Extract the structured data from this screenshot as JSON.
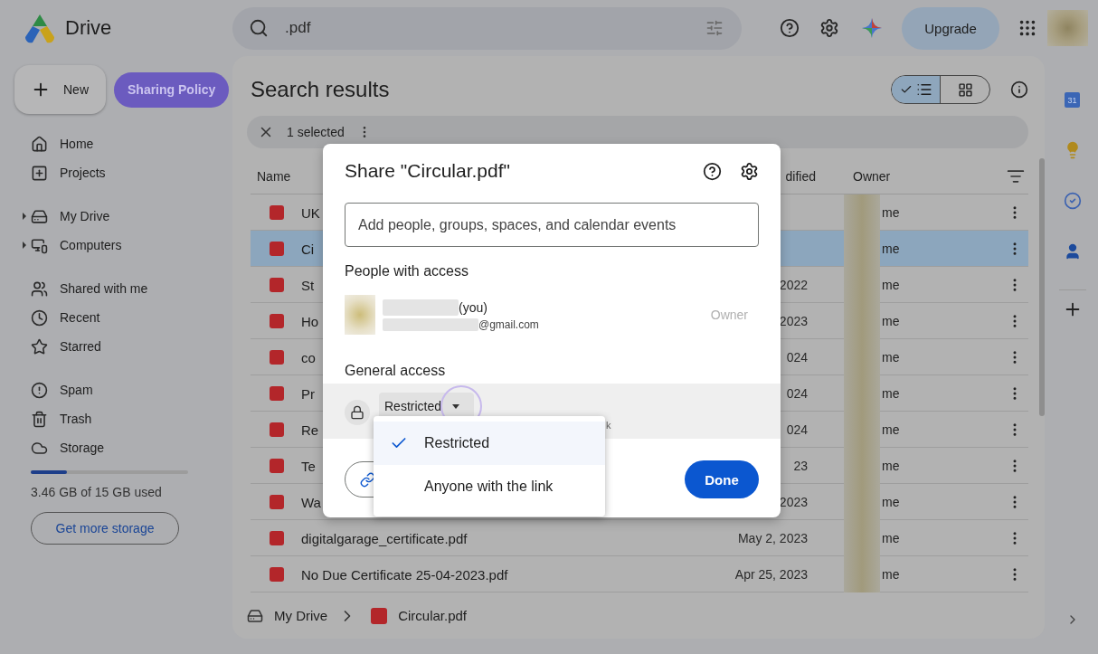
{
  "app": {
    "name": "Drive"
  },
  "search": {
    "value": ".pdf"
  },
  "topbar": {
    "upgrade": "Upgrade"
  },
  "sidebar": {
    "new_button": "New",
    "policy_button": "Sharing Policy",
    "groups": [
      [
        {
          "label": "Home",
          "expandable": false
        },
        {
          "label": "Projects",
          "expandable": false
        }
      ],
      [
        {
          "label": "My Drive",
          "expandable": true
        },
        {
          "label": "Computers",
          "expandable": true
        }
      ],
      [
        {
          "label": "Shared with me",
          "expandable": false
        },
        {
          "label": "Recent",
          "expandable": false
        },
        {
          "label": "Starred",
          "expandable": false
        }
      ],
      [
        {
          "label": "Spam",
          "expandable": false
        },
        {
          "label": "Trash",
          "expandable": false
        },
        {
          "label": "Storage",
          "expandable": false
        }
      ]
    ],
    "storage": {
      "level": 0.23,
      "text": "3.46 GB of 15 GB used",
      "button": "Get more storage"
    }
  },
  "main": {
    "title": "Search results",
    "views": [
      {
        "kind": "list",
        "selected": true
      },
      {
        "kind": "grid",
        "selected": false
      }
    ],
    "selection": {
      "count_text": "1 selected"
    },
    "columns": [
      "Name",
      "dified",
      "Owner"
    ],
    "rows": [
      {
        "name": "UK",
        "owner": "me",
        "selected": false
      },
      {
        "name": "Ci",
        "owner": "me",
        "selected": true
      },
      {
        "name": "St",
        "date": "2022",
        "owner": "me",
        "selected": false
      },
      {
        "name": "Ho",
        "date": "2023",
        "owner": "me",
        "selected": false
      },
      {
        "name": "co",
        "date": "024",
        "owner": "me",
        "selected": false
      },
      {
        "name": "Pr",
        "date": "024",
        "owner": "me",
        "selected": false
      },
      {
        "name": "Re",
        "date": "024",
        "owner": "me",
        "selected": false
      },
      {
        "name": "Te",
        "date": "23",
        "owner": "me",
        "selected": false
      },
      {
        "name": "Wa",
        "date": "2023",
        "owner": "me",
        "selected": false
      },
      {
        "name": "digitalgarage_certificate.pdf",
        "date": "May 2, 2023",
        "owner": "me",
        "selected": false
      },
      {
        "name": "No Due Certificate 25-04-2023.pdf",
        "date": "Apr 25, 2023",
        "owner": "me",
        "selected": false
      }
    ],
    "breadcrumb": [
      {
        "kind": "drive",
        "label": "My Drive"
      },
      {
        "kind": "pdf",
        "label": "Circular.pdf"
      }
    ]
  },
  "rail": {
    "calendar_day": "31"
  },
  "dialog": {
    "title": "Share \"Circular.pdf\"",
    "input_placeholder": "Add people, groups, spaces, and calendar events",
    "people_heading": "People with access",
    "people": [
      {
        "name_suffix": "(you)",
        "email_suffix": "@gmail.com",
        "role": "Owner"
      }
    ],
    "general_heading": "General access",
    "access_value": "Restricted",
    "access_description": "k",
    "done": "Done",
    "menu": [
      {
        "label": "Restricted",
        "selected": true
      },
      {
        "label": "Anyone with the link",
        "selected": false
      }
    ]
  }
}
